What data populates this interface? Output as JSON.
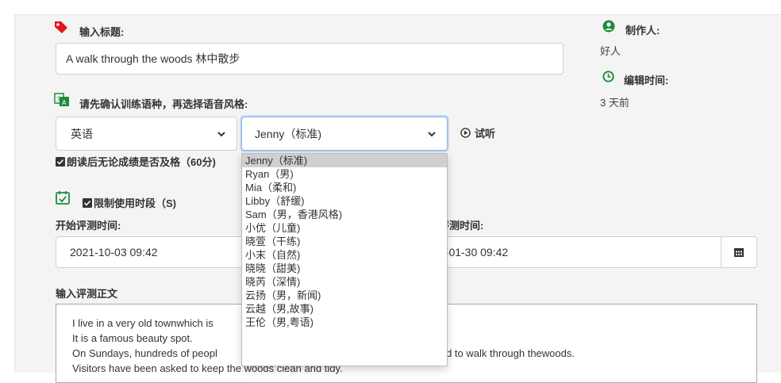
{
  "form": {
    "title_label": "输入标题:",
    "title_value": "A walk through the woods 林中散步",
    "voice_label": "请先确认训练语种，再选择语音风格:",
    "language_select": "英语",
    "voice_select": "Jenny（标准)",
    "listen_label": "试听",
    "pass_checkbox_label": "朗读后无论成绩是否及格（60分)",
    "limit_checkbox_label": "限制使用时段（S)",
    "start_label": "开始评测时间:",
    "start_value": "2021-10-03 09:42",
    "end_label_partial": "评测时间:",
    "end_value_partial": "2-01-30 09:42",
    "body_label": "输入评测正文",
    "body_lines": [
      "I live in a very old townwhich is",
      "It is a famous beauty spot.",
      "On Sundays, hundreds of peopl",
      "Visitors have been asked to keep the woods clean and tidy."
    ],
    "body_line3_tail": "nd to walk through thewoods."
  },
  "info": {
    "author_label": "制作人:",
    "author_value": "好人",
    "edit_time_label": "编辑时间:",
    "edit_time_value": "3 天前"
  },
  "dropdown": {
    "options": [
      "Jenny（标准)",
      "Ryan（男)",
      "Mia（柔和)",
      "Libby（舒缓)",
      "Sam（男，香港风格)",
      "小优（儿童)",
      "晓萱（干练)",
      "小末（自然)",
      "晓晓（甜美)",
      "晓芮（深情)",
      "云扬（男，新闻)",
      "云越（男,故事)",
      "王伦（男,粤语)"
    ],
    "selected_index": 0
  },
  "colors": {
    "tag": "#e0151f",
    "green": "#1d8a3c",
    "selected_option_bg": "#cfcfcf"
  }
}
